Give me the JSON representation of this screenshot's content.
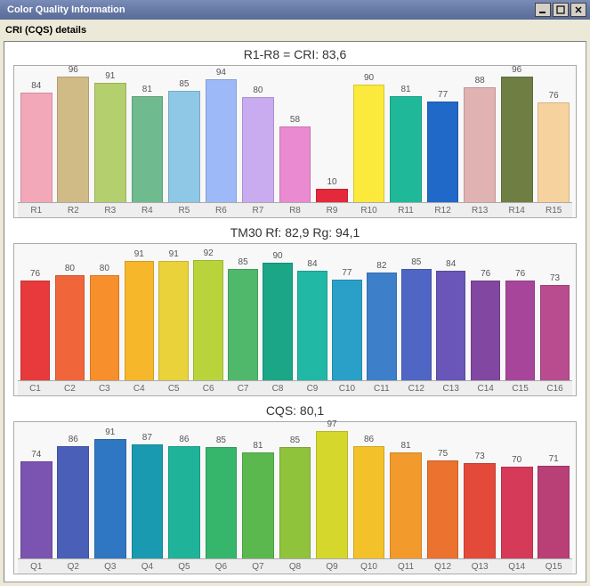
{
  "window": {
    "title": "Color Quality Information",
    "subtitle": "CRI (CQS) details"
  },
  "chart_data": [
    {
      "type": "bar",
      "title": "R1-R8 = CRI: 83,6",
      "ylim": [
        0,
        100
      ],
      "categories": [
        "R1",
        "R2",
        "R3",
        "R4",
        "R5",
        "R6",
        "R7",
        "R8",
        "R9",
        "R10",
        "R11",
        "R12",
        "R13",
        "R14",
        "R15"
      ],
      "values": [
        84,
        96,
        91,
        81,
        85,
        94,
        80,
        58,
        10,
        90,
        81,
        77,
        88,
        96,
        76
      ],
      "colors": [
        "#f2a8b8",
        "#d0bb86",
        "#b4cf6d",
        "#6fba8f",
        "#8ec8e6",
        "#9db9f7",
        "#c9abf0",
        "#ea8ad1",
        "#e6283c",
        "#fbe93c",
        "#1fb99a",
        "#2169c8",
        "#e0b2b2",
        "#6f7f44",
        "#f6d39e"
      ]
    },
    {
      "type": "bar",
      "title": "TM30  Rf: 82,9   Rg: 94,1",
      "ylim": [
        0,
        100
      ],
      "categories": [
        "C1",
        "C2",
        "C3",
        "C4",
        "C5",
        "C6",
        "C7",
        "C8",
        "C9",
        "C10",
        "C11",
        "C12",
        "C13",
        "C14",
        "C15",
        "C16"
      ],
      "values": [
        76,
        80,
        80,
        91,
        91,
        92,
        85,
        90,
        84,
        77,
        82,
        85,
        84,
        76,
        76,
        73
      ],
      "colors": [
        "#e83a3c",
        "#f0663a",
        "#f78f2c",
        "#f6b72a",
        "#ead23a",
        "#b9d43b",
        "#4fb86a",
        "#1aa687",
        "#21b8a6",
        "#2aa0c8",
        "#3e7fca",
        "#5066c4",
        "#6a55b8",
        "#8247a0",
        "#a7459a",
        "#b94c8e"
      ]
    },
    {
      "type": "bar",
      "title": "CQS: 80,1",
      "ylim": [
        0,
        100
      ],
      "categories": [
        "Q1",
        "Q2",
        "Q3",
        "Q4",
        "Q5",
        "Q6",
        "Q7",
        "Q8",
        "Q9",
        "Q10",
        "Q11",
        "Q12",
        "Q13",
        "Q14",
        "Q15"
      ],
      "values": [
        74,
        86,
        91,
        87,
        86,
        85,
        81,
        85,
        97,
        86,
        81,
        75,
        73,
        70,
        71
      ],
      "colors": [
        "#7a54b0",
        "#4a5fb8",
        "#2f77c2",
        "#1a9ab0",
        "#1fb49a",
        "#35b66a",
        "#5bb84f",
        "#8fc33c",
        "#d6d72c",
        "#f3c12a",
        "#f39a2c",
        "#ec7230",
        "#e44a3a",
        "#d53a58",
        "#b84076"
      ]
    }
  ]
}
